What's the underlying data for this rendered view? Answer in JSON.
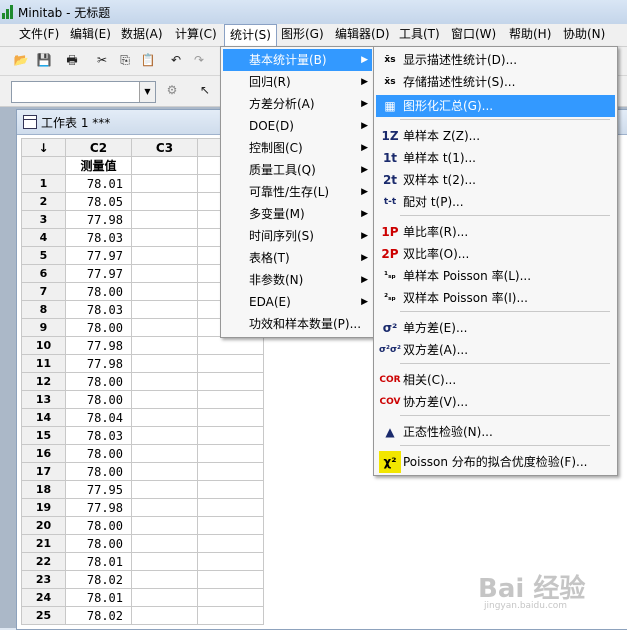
{
  "window": {
    "title": "Minitab - 无标题"
  },
  "menubar": {
    "items": [
      "文件(F)",
      "编辑(E)",
      "数据(A)",
      "计算(C)",
      "统计(S)",
      "图形(G)",
      "编辑器(D)",
      "工具(T)",
      "窗口(W)",
      "帮助(H)",
      "协助(N)"
    ],
    "active": "统计(S)"
  },
  "worksheet": {
    "title": "工作表 1 ***",
    "corner": "↓",
    "columns": [
      "C2",
      "C3"
    ],
    "column_names": [
      "测量值",
      ""
    ],
    "rows": [
      {
        "n": "1",
        "v": "78.01"
      },
      {
        "n": "2",
        "v": "78.05"
      },
      {
        "n": "3",
        "v": "77.98"
      },
      {
        "n": "4",
        "v": "78.03"
      },
      {
        "n": "5",
        "v": "77.97"
      },
      {
        "n": "6",
        "v": "77.97"
      },
      {
        "n": "7",
        "v": "78.00"
      },
      {
        "n": "8",
        "v": "78.03"
      },
      {
        "n": "9",
        "v": "78.00"
      },
      {
        "n": "10",
        "v": "77.98"
      },
      {
        "n": "11",
        "v": "77.98"
      },
      {
        "n": "12",
        "v": "78.00"
      },
      {
        "n": "13",
        "v": "78.00"
      },
      {
        "n": "14",
        "v": "78.04"
      },
      {
        "n": "15",
        "v": "78.03"
      },
      {
        "n": "16",
        "v": "78.00"
      },
      {
        "n": "17",
        "v": "78.00"
      },
      {
        "n": "18",
        "v": "77.95"
      },
      {
        "n": "19",
        "v": "77.98"
      },
      {
        "n": "20",
        "v": "78.00"
      },
      {
        "n": "21",
        "v": "78.00"
      },
      {
        "n": "22",
        "v": "78.01"
      },
      {
        "n": "23",
        "v": "78.02"
      },
      {
        "n": "24",
        "v": "78.01"
      },
      {
        "n": "25",
        "v": "78.02"
      }
    ]
  },
  "stat_menu": {
    "items": [
      {
        "label": "基本统计量(B)",
        "highlighted": true
      },
      {
        "label": "回归(R)"
      },
      {
        "label": "方差分析(A)"
      },
      {
        "label": "DOE(D)"
      },
      {
        "label": "控制图(C)"
      },
      {
        "label": "质量工具(Q)"
      },
      {
        "label": "可靠性/生存(L)"
      },
      {
        "label": "多变量(M)"
      },
      {
        "label": "时间序列(S)"
      },
      {
        "label": "表格(T)"
      },
      {
        "label": "非参数(N)"
      },
      {
        "label": "EDA(E)"
      },
      {
        "label": "功效和样本数量(P)..."
      }
    ]
  },
  "basic_stats_menu": {
    "items": [
      {
        "icon": "x̄s",
        "icon_name": "display-descriptive-icon",
        "label": "显示描述性统计(D)..."
      },
      {
        "icon": "x̄s",
        "icon_name": "store-descriptive-icon",
        "label": "存储描述性统计(S)..."
      },
      {
        "icon": "▦",
        "icon_name": "graphical-summary-icon",
        "label": "图形化汇总(G)...",
        "highlighted": true
      },
      {
        "icon": "1Z",
        "icon_name": "one-sample-z-icon",
        "label": "单样本 Z(Z)..."
      },
      {
        "icon": "1t",
        "icon_name": "one-sample-t-icon",
        "label": "单样本 t(1)..."
      },
      {
        "icon": "2t",
        "icon_name": "two-sample-t-icon",
        "label": "双样本 t(2)..."
      },
      {
        "icon": "t-t",
        "icon_name": "paired-t-icon",
        "label": "配对 t(P)..."
      },
      {
        "icon": "1P",
        "icon_name": "one-proportion-icon",
        "label": "单比率(R)..."
      },
      {
        "icon": "2P",
        "icon_name": "two-proportions-icon",
        "label": "双比率(O)..."
      },
      {
        "icon": "¹ₛₚ",
        "icon_name": "one-sample-poisson-icon",
        "label": "单样本 Poisson 率(L)..."
      },
      {
        "icon": "²ₛₚ",
        "icon_name": "two-sample-poisson-icon",
        "label": "双样本 Poisson 率(I)..."
      },
      {
        "icon": "σ²",
        "icon_name": "one-variance-icon",
        "label": "单方差(E)..."
      },
      {
        "icon": "σ²σ²",
        "icon_name": "two-variances-icon",
        "label": "双方差(A)..."
      },
      {
        "icon": "COR",
        "icon_name": "correlation-icon",
        "label": "相关(C)..."
      },
      {
        "icon": "COV",
        "icon_name": "covariance-icon",
        "label": "协方差(V)..."
      },
      {
        "icon": "▲",
        "icon_name": "normality-test-icon",
        "label": "正态性检验(N)..."
      },
      {
        "icon": "χ²",
        "icon_name": "poisson-gof-icon",
        "label": "Poisson 分布的拟合优度检验(F)..."
      }
    ]
  },
  "colors": {
    "highlight": "#3399ff",
    "red_icon": "#cc0000",
    "navy_icon": "#1a2a6c"
  },
  "watermark": {
    "text": "Bai 经验",
    "sub": "jingyan.baidu.com"
  }
}
